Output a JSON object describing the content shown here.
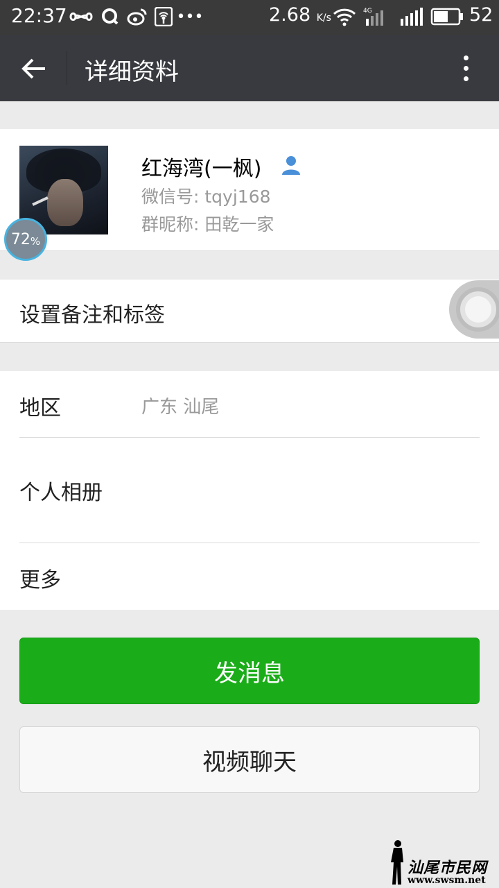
{
  "status_bar": {
    "time": "22:37",
    "network_speed": "2.68",
    "network_speed_unit": "K/s",
    "network_type": "4G",
    "battery_level": "52",
    "icons": [
      "infinity-icon",
      "q-app-icon",
      "weibo-icon",
      "hotspot-icon",
      "more-notifications-icon",
      "wifi-icon",
      "signal-4g-icon",
      "signal-icon",
      "battery-icon"
    ]
  },
  "title_bar": {
    "title": "详细资料",
    "back_icon": "arrow-left-icon",
    "menu_icon": "more-vertical-icon"
  },
  "profile": {
    "name": "红海湾(一枫)",
    "wechat_id": "微信号: tqyj168",
    "group_nickname": "群昵称: 田乾一家",
    "contact_icon": "contact-person-icon",
    "badge_value": "72",
    "badge_unit": "%"
  },
  "remark": {
    "label": "设置备注和标签"
  },
  "info": {
    "region_label": "地区",
    "region_value": "广东  汕尾",
    "album_label": "个人相册",
    "more_label": "更多"
  },
  "actions": {
    "send_message": "发消息",
    "video_chat": "视频聊天"
  },
  "watermark": {
    "title": "汕尾市民网",
    "url": "www.swsm.net"
  },
  "colors": {
    "title_bar": "#393a3f",
    "status_bar": "#3a3a3a",
    "primary_green": "#1aad19",
    "background": "#ebebeb",
    "contact_icon": "#4a90d9"
  }
}
